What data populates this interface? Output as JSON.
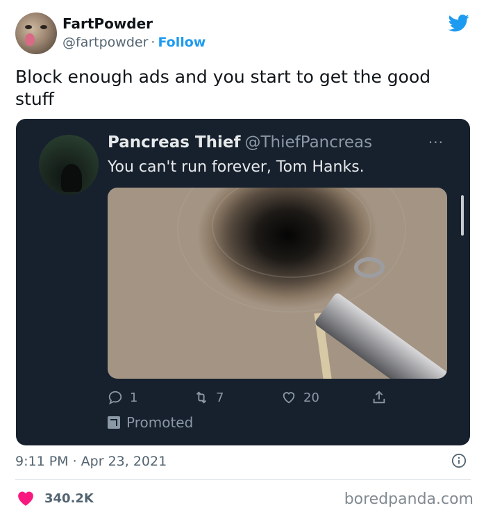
{
  "author": {
    "name": "FartPowder",
    "handle": "@fartpowder",
    "separator": "·",
    "follow_label": "Follow"
  },
  "tweet": {
    "text": "Block enough ads and you start to get the good stuff",
    "timestamp": "9:11 PM · Apr 23, 2021"
  },
  "embedded_tweet": {
    "name": "Pancreas Thief",
    "handle": "@ThiefPancreas",
    "more_label": "···",
    "text": "You can't run forever, Tom Hanks.",
    "replies": "1",
    "retweets": "7",
    "likes": "20",
    "promoted_label": "Promoted"
  },
  "footer": {
    "likes_count": "340.2K",
    "watermark": "boredpanda.com"
  },
  "colors": {
    "twitter_blue": "#1d9bf0",
    "heart": "#f91880",
    "embed_bg": "#17212e"
  },
  "icons": [
    "twitter-bird-icon",
    "reply-icon",
    "retweet-icon",
    "like-icon",
    "share-icon",
    "promoted-icon",
    "info-icon",
    "heart-icon"
  ]
}
